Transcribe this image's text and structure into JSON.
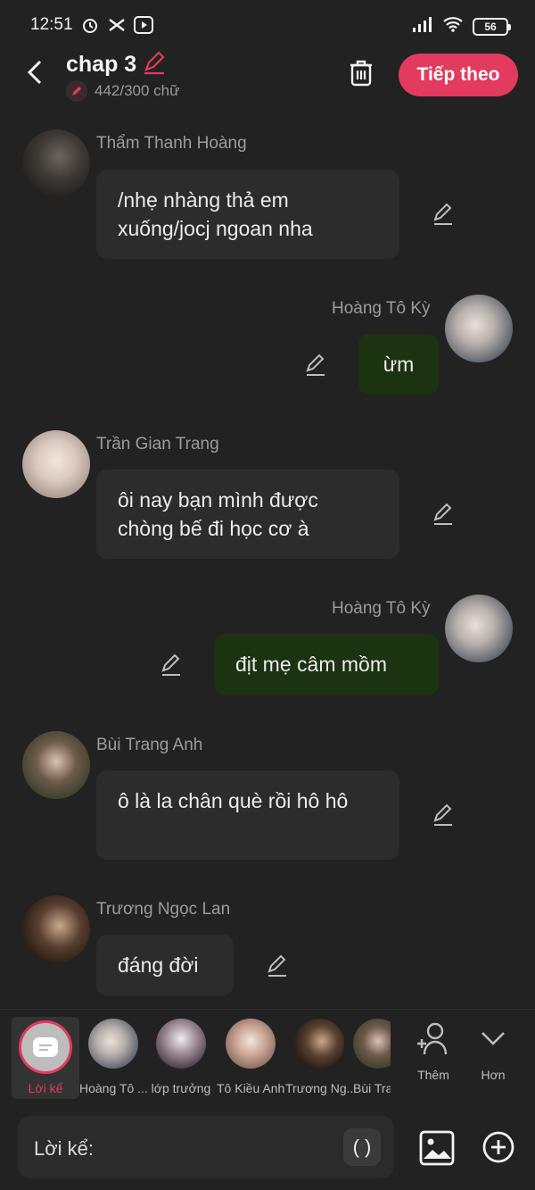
{
  "status": {
    "time": "12:51",
    "battery": "56"
  },
  "header": {
    "title": "chap 3",
    "word_count": "442/300 chữ",
    "next_label": "Tiếp theo"
  },
  "messages": [
    {
      "sender": "Thẩm Thanh Hoàng",
      "text": "/nhẹ nhàng thả em xuống/jocj ngoan nha",
      "side": "left"
    },
    {
      "sender": "Hoàng Tô Kỳ",
      "text": "ừm",
      "side": "right"
    },
    {
      "sender": "Trần Gian Trang",
      "text": "ôi nay bạn mình được chòng bế đi học cơ à",
      "side": "left"
    },
    {
      "sender": "Hoàng Tô Kỳ",
      "text": "địt mẹ câm mồm",
      "side": "right"
    },
    {
      "sender": "Bùi Trang Anh",
      "text": "ô là la chân què rồi hô hô",
      "side": "left"
    },
    {
      "sender": "Trương Ngọc Lan",
      "text": "đáng đời",
      "side": "left"
    }
  ],
  "characters": {
    "narrator_label": "Lời kể",
    "items": [
      "Hoàng Tô ...",
      "lớp trưởng",
      "Tô Kiều Anh",
      "Trương Ng...",
      "Bùi Tra"
    ],
    "add_label": "Thêm",
    "more_label": "Hơn"
  },
  "composer": {
    "placeholder": "Lời kể:",
    "paren_label": "( )"
  },
  "colors": {
    "accent": "#e23b5f",
    "bubble": "#2c2c2c",
    "bubble_me": "#1c3312",
    "background": "#222222"
  }
}
